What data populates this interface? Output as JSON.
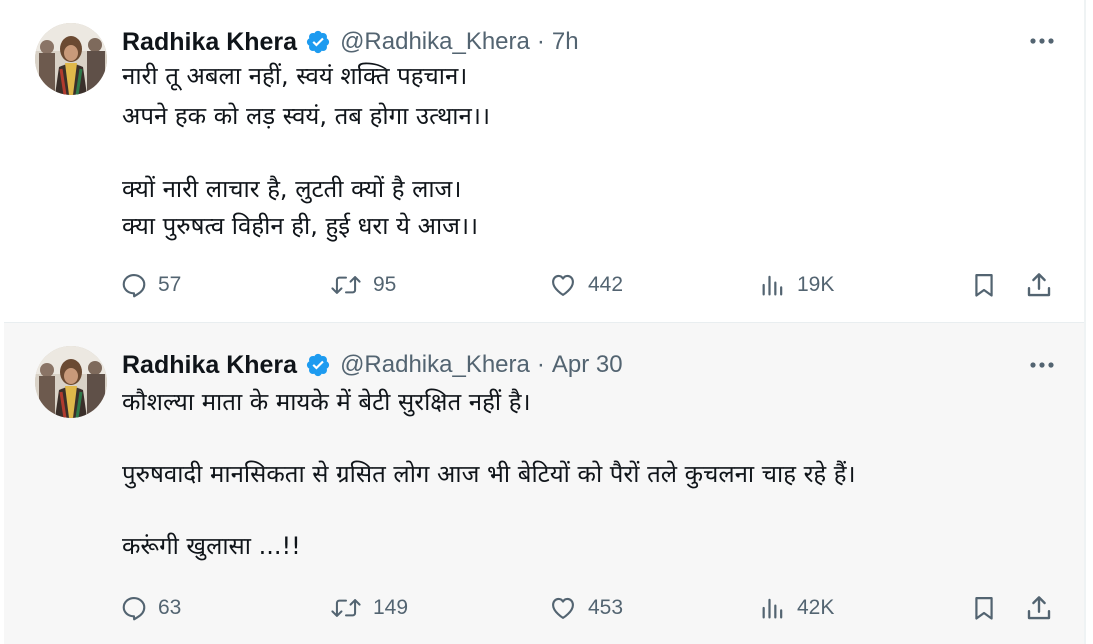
{
  "tweets": [
    {
      "author_name": "Radhika Khera",
      "handle": "@Radhika_Khera",
      "separator": "·",
      "time": "7h",
      "lines": [
        "नारी तू अबला नहीं, स्वयं शक्ति पहचान।",
        "अपने हक को लड़ स्वयं, तब होगा उत्थान।।",
        "क्यों नारी लाचार है, लुटती क्यों है लाज।",
        "क्या पुरुषत्व विहीन ही, हुई धरा ये आज।।"
      ],
      "replies": "57",
      "retweets": "95",
      "likes": "442",
      "views": "19K"
    },
    {
      "author_name": "Radhika Khera",
      "handle": "@Radhika_Khera",
      "separator": "·",
      "time": "Apr 30",
      "lines": [
        "कौशल्या माता के मायके में बेटी सुरक्षित नहीं है।",
        "पुरुषवादी मानसिकता से ग्रसित लोग आज भी बेटियों को पैरों तले कुचलना चाह रहे हैं।",
        "करूंगी खुलासा ...!!"
      ],
      "replies": "63",
      "retweets": "149",
      "likes": "453",
      "views": "42K"
    }
  ],
  "icons": {
    "verified": "verified-badge-icon",
    "more": "more-options-icon",
    "reply": "reply-icon",
    "retweet": "retweet-icon",
    "like": "like-icon",
    "views": "views-icon",
    "bookmark": "bookmark-icon",
    "share": "share-icon"
  },
  "colors": {
    "verified": "#1d9bf0",
    "muted": "#536471",
    "text": "#0f1419"
  }
}
